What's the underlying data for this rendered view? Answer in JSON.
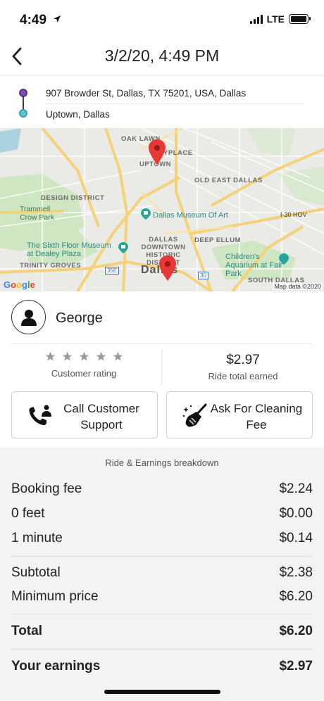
{
  "status_bar": {
    "time": "4:49",
    "network": "LTE"
  },
  "header": {
    "title": "3/2/20, 4:49 PM"
  },
  "route": {
    "from": "907 Browder St, Dallas, TX 75201, USA, Dallas",
    "to": "Uptown, Dallas"
  },
  "map": {
    "labels": {
      "oak_lawn": "OAK LAWN",
      "uptown_place": "YPLACE",
      "uptown": "UPTOWN",
      "old_east": "OLD EAST DALLAS",
      "design": "DESIGN DISTRICT",
      "trammell": "Trammell Crow Park",
      "museum_art": "Dallas Museum Of Art",
      "downtown": "DALLAS DOWNTOWN HISTORIC DISTRICT",
      "deep_ellum": "DEEP ELLUM",
      "sixth_floor": "The Sixth Floor Museum at Dealey Plaza",
      "childrens": "Children's Aquarium at Fair Park",
      "trinity": "TRINITY GROVES",
      "dallas": "Dallas",
      "south_dallas": "SOUTH DALLAS",
      "hov": "I-30 HOV",
      "i35e": "35E",
      "i30": "30"
    },
    "google": "Google",
    "attribution": "Map data ©2020"
  },
  "driver": {
    "name": "George"
  },
  "stats": {
    "rating_label": "Customer rating",
    "rating_stars": 5,
    "earned_value": "$2.97",
    "earned_label": "Ride total earned"
  },
  "actions": {
    "call_label": "Call Customer Support",
    "clean_label": "Ask For Cleaning Fee"
  },
  "breakdown": {
    "title": "Ride & Earnings breakdown",
    "items": [
      {
        "label": "Booking fee",
        "value": "$2.24"
      },
      {
        "label": "0 feet",
        "value": "$0.00"
      },
      {
        "label": "1 minute",
        "value": "$0.14"
      },
      {
        "label": "Subtotal",
        "value": "$2.38"
      },
      {
        "label": "Minimum price",
        "value": "$6.20"
      },
      {
        "label": "Total",
        "value": "$6.20"
      },
      {
        "label": "Your earnings",
        "value": "$2.97"
      }
    ]
  },
  "colors": {
    "route_from": "#7b4da8",
    "route_to": "#5ec3d6",
    "map_pin": "#e53935",
    "breakdown_bg": "#f3f3f3"
  }
}
